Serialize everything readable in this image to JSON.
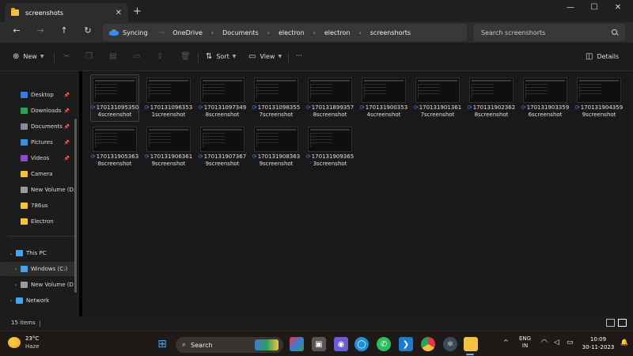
{
  "window": {
    "tab_title": "screenshots",
    "tab_close": "✕",
    "new_tab": "+",
    "minimize": "—",
    "maximize": "☐",
    "close": "✕"
  },
  "nav": {
    "back": "←",
    "forward": "→",
    "up": "↑",
    "refresh": "↻"
  },
  "address": {
    "sync_label": "Syncing",
    "overflow": "···",
    "breadcrumb": [
      "OneDrive",
      "Documents",
      "electron",
      "electron",
      "screenshorts"
    ],
    "separator": "›"
  },
  "search": {
    "placeholder": "Search screenshorts"
  },
  "commandbar": {
    "new_label": "New",
    "sort_label": "Sort",
    "view_label": "View",
    "more": "···",
    "details_label": "Details"
  },
  "sidebar": {
    "quick_access": [
      {
        "label": "Desktop",
        "pinned": true,
        "color": "#3a7bd5"
      },
      {
        "label": "Downloads",
        "pinned": true,
        "color": "#2e9e5b"
      },
      {
        "label": "Documents",
        "pinned": true,
        "color": "#7f8ea3"
      },
      {
        "label": "Pictures",
        "pinned": true,
        "color": "#3b8fd9"
      },
      {
        "label": "Videos",
        "pinned": true,
        "color": "#8a4fc7"
      },
      {
        "label": "Camera",
        "pinned": false,
        "color": "#f3c340"
      },
      {
        "label": "New Volume (D:",
        "pinned": false,
        "color": "#9a9a9a"
      },
      {
        "label": "786us",
        "pinned": false,
        "color": "#f3c340"
      },
      {
        "label": "Electron",
        "pinned": false,
        "color": "#f3c340"
      }
    ],
    "this_pc": "This PC",
    "drives": [
      "Windows (C:)",
      "New Volume (D"
    ],
    "network": "Network"
  },
  "files": [
    {
      "line1": "170131095350",
      "line2": "4screenshot"
    },
    {
      "line1": "170131096353",
      "line2": "1screenshot"
    },
    {
      "line1": "170131097349",
      "line2": "8screenshot"
    },
    {
      "line1": "170131098355",
      "line2": "7screenshot"
    },
    {
      "line1": "170131899357",
      "line2": "8screenshot"
    },
    {
      "line1": "170131900353",
      "line2": "4screenshot"
    },
    {
      "line1": "170131901361",
      "line2": "7screenshot"
    },
    {
      "line1": "170131902362",
      "line2": "8screenshot"
    },
    {
      "line1": "170131903359",
      "line2": "6screenshot"
    },
    {
      "line1": "170131904359",
      "line2": "9screenshot"
    },
    {
      "line1": "170131905363",
      "line2": "8screenshot"
    },
    {
      "line1": "170131906361",
      "line2": "9screenshot"
    },
    {
      "line1": "170131907367",
      "line2": "9screenshot"
    },
    {
      "line1": "170131908363",
      "line2": "9screenshot"
    },
    {
      "line1": "170131909365",
      "line2": "3screenshot"
    }
  ],
  "status": {
    "item_count": "15 items"
  },
  "taskbar": {
    "temperature": "23°C",
    "condition": "Haze",
    "search_label": "Search",
    "language_top": "ENG",
    "language_bottom": "IN",
    "time": "10:09",
    "date": "30-11-2023",
    "tray_up": "^"
  },
  "colors": {
    "accent": "#3a8ee6",
    "folder": "#f3c340"
  }
}
